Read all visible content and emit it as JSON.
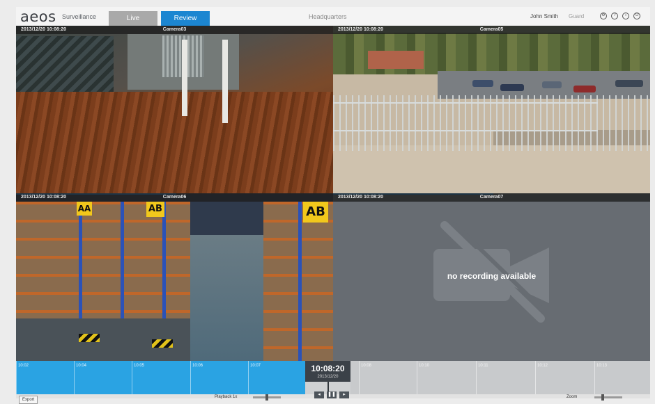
{
  "app": {
    "logo": "aeos",
    "product": "Surveillance",
    "tabs": [
      {
        "label": "Live",
        "active": false
      },
      {
        "label": "Review",
        "active": true
      }
    ],
    "site": "Headquarters",
    "user": {
      "name": "John Smith",
      "role": "Guard"
    },
    "icons": [
      "settings-icon",
      "help-icon",
      "info-icon",
      "power-icon"
    ]
  },
  "tiles": [
    {
      "timestamp": "2013/12/20  10:08:20",
      "camera": "Camera03",
      "has_video": true
    },
    {
      "timestamp": "2013/12/20  10:08:20",
      "camera": "Camera05",
      "has_video": true
    },
    {
      "timestamp": "2013/12/20  10:08:20",
      "camera": "Camera06",
      "has_video": true
    },
    {
      "timestamp": "2013/12/20  10:08:20",
      "camera": "Camera07",
      "has_video": false,
      "message": "no recording available"
    }
  ],
  "warehouse_signs": [
    "AA",
    "AB",
    "AB"
  ],
  "timeline": {
    "current_time": "10:08:20",
    "current_date": "2013/12/20",
    "labels_past": [
      "10:02",
      "10:04",
      "10:05",
      "10:06",
      "10:07"
    ],
    "labels_future": [
      "10:08",
      "10:10",
      "10:11",
      "10:12",
      "10:13"
    ]
  },
  "controls": {
    "left_button": "Export",
    "speed_label": "Playback 1x",
    "zoom_label": "Zoom"
  },
  "colors": {
    "accent": "#1c86d1",
    "timeline_past": "#2aa3e3",
    "no_recording_bg": "#676c72"
  }
}
